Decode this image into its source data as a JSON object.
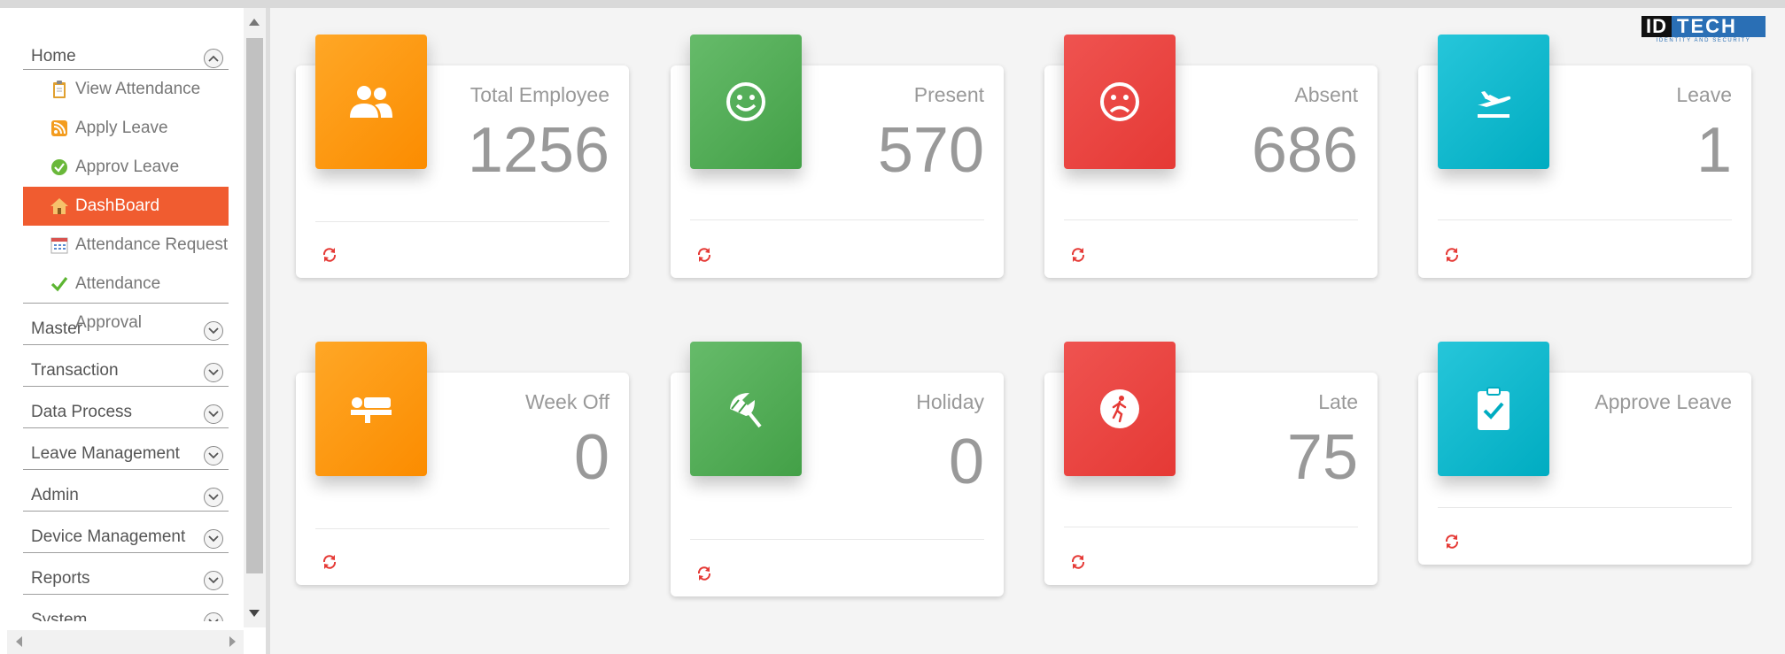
{
  "logo": {
    "part1": "ID",
    "part2": "TECH",
    "tagline": "IDENTITY AND SECURITY"
  },
  "sidebar": {
    "home": {
      "label": "Home",
      "items": [
        {
          "label": "View Attendance",
          "icon": "clipboard-icon"
        },
        {
          "label": "Apply Leave",
          "icon": "rss-icon"
        },
        {
          "label": "Approv Leave",
          "icon": "check-circle-icon"
        },
        {
          "label": "DashBoard",
          "icon": "home-icon",
          "active": true
        },
        {
          "label": "Attendance Request",
          "icon": "calendar-icon"
        },
        {
          "label": "Attendance Approval",
          "icon": "checkmark-icon"
        }
      ]
    },
    "sections": [
      {
        "label": "Master"
      },
      {
        "label": "Transaction"
      },
      {
        "label": "Data Process"
      },
      {
        "label": "Leave Management"
      },
      {
        "label": "Admin"
      },
      {
        "label": "Device Management"
      },
      {
        "label": "Reports"
      },
      {
        "label": "System"
      }
    ]
  },
  "cards": [
    {
      "title": "Total Employee",
      "value": "1256",
      "icon": "people-icon",
      "color": "#fb8c00"
    },
    {
      "title": "Present",
      "value": "570",
      "icon": "smile-icon",
      "color": "#43a047"
    },
    {
      "title": "Absent",
      "value": "686",
      "icon": "sad-icon",
      "color": "#e53935"
    },
    {
      "title": "Leave",
      "value": "1",
      "icon": "flight-takeoff-icon",
      "color": "#00acc1"
    },
    {
      "title": "Week Off",
      "value": "0",
      "icon": "bed-icon",
      "color": "#fb8c00"
    },
    {
      "title": "Holiday",
      "value": "0",
      "icon": "beach-umbrella-icon",
      "color": "#43a047"
    },
    {
      "title": "Late",
      "value": "75",
      "icon": "running-man-icon",
      "color": "#e53935"
    },
    {
      "title": "Approve Leave",
      "value": "",
      "icon": "clipboard-check-icon",
      "color": "#00acc1"
    }
  ],
  "colors": {
    "active_menu": "#f05c30",
    "refresh_icon": "#e53935"
  }
}
